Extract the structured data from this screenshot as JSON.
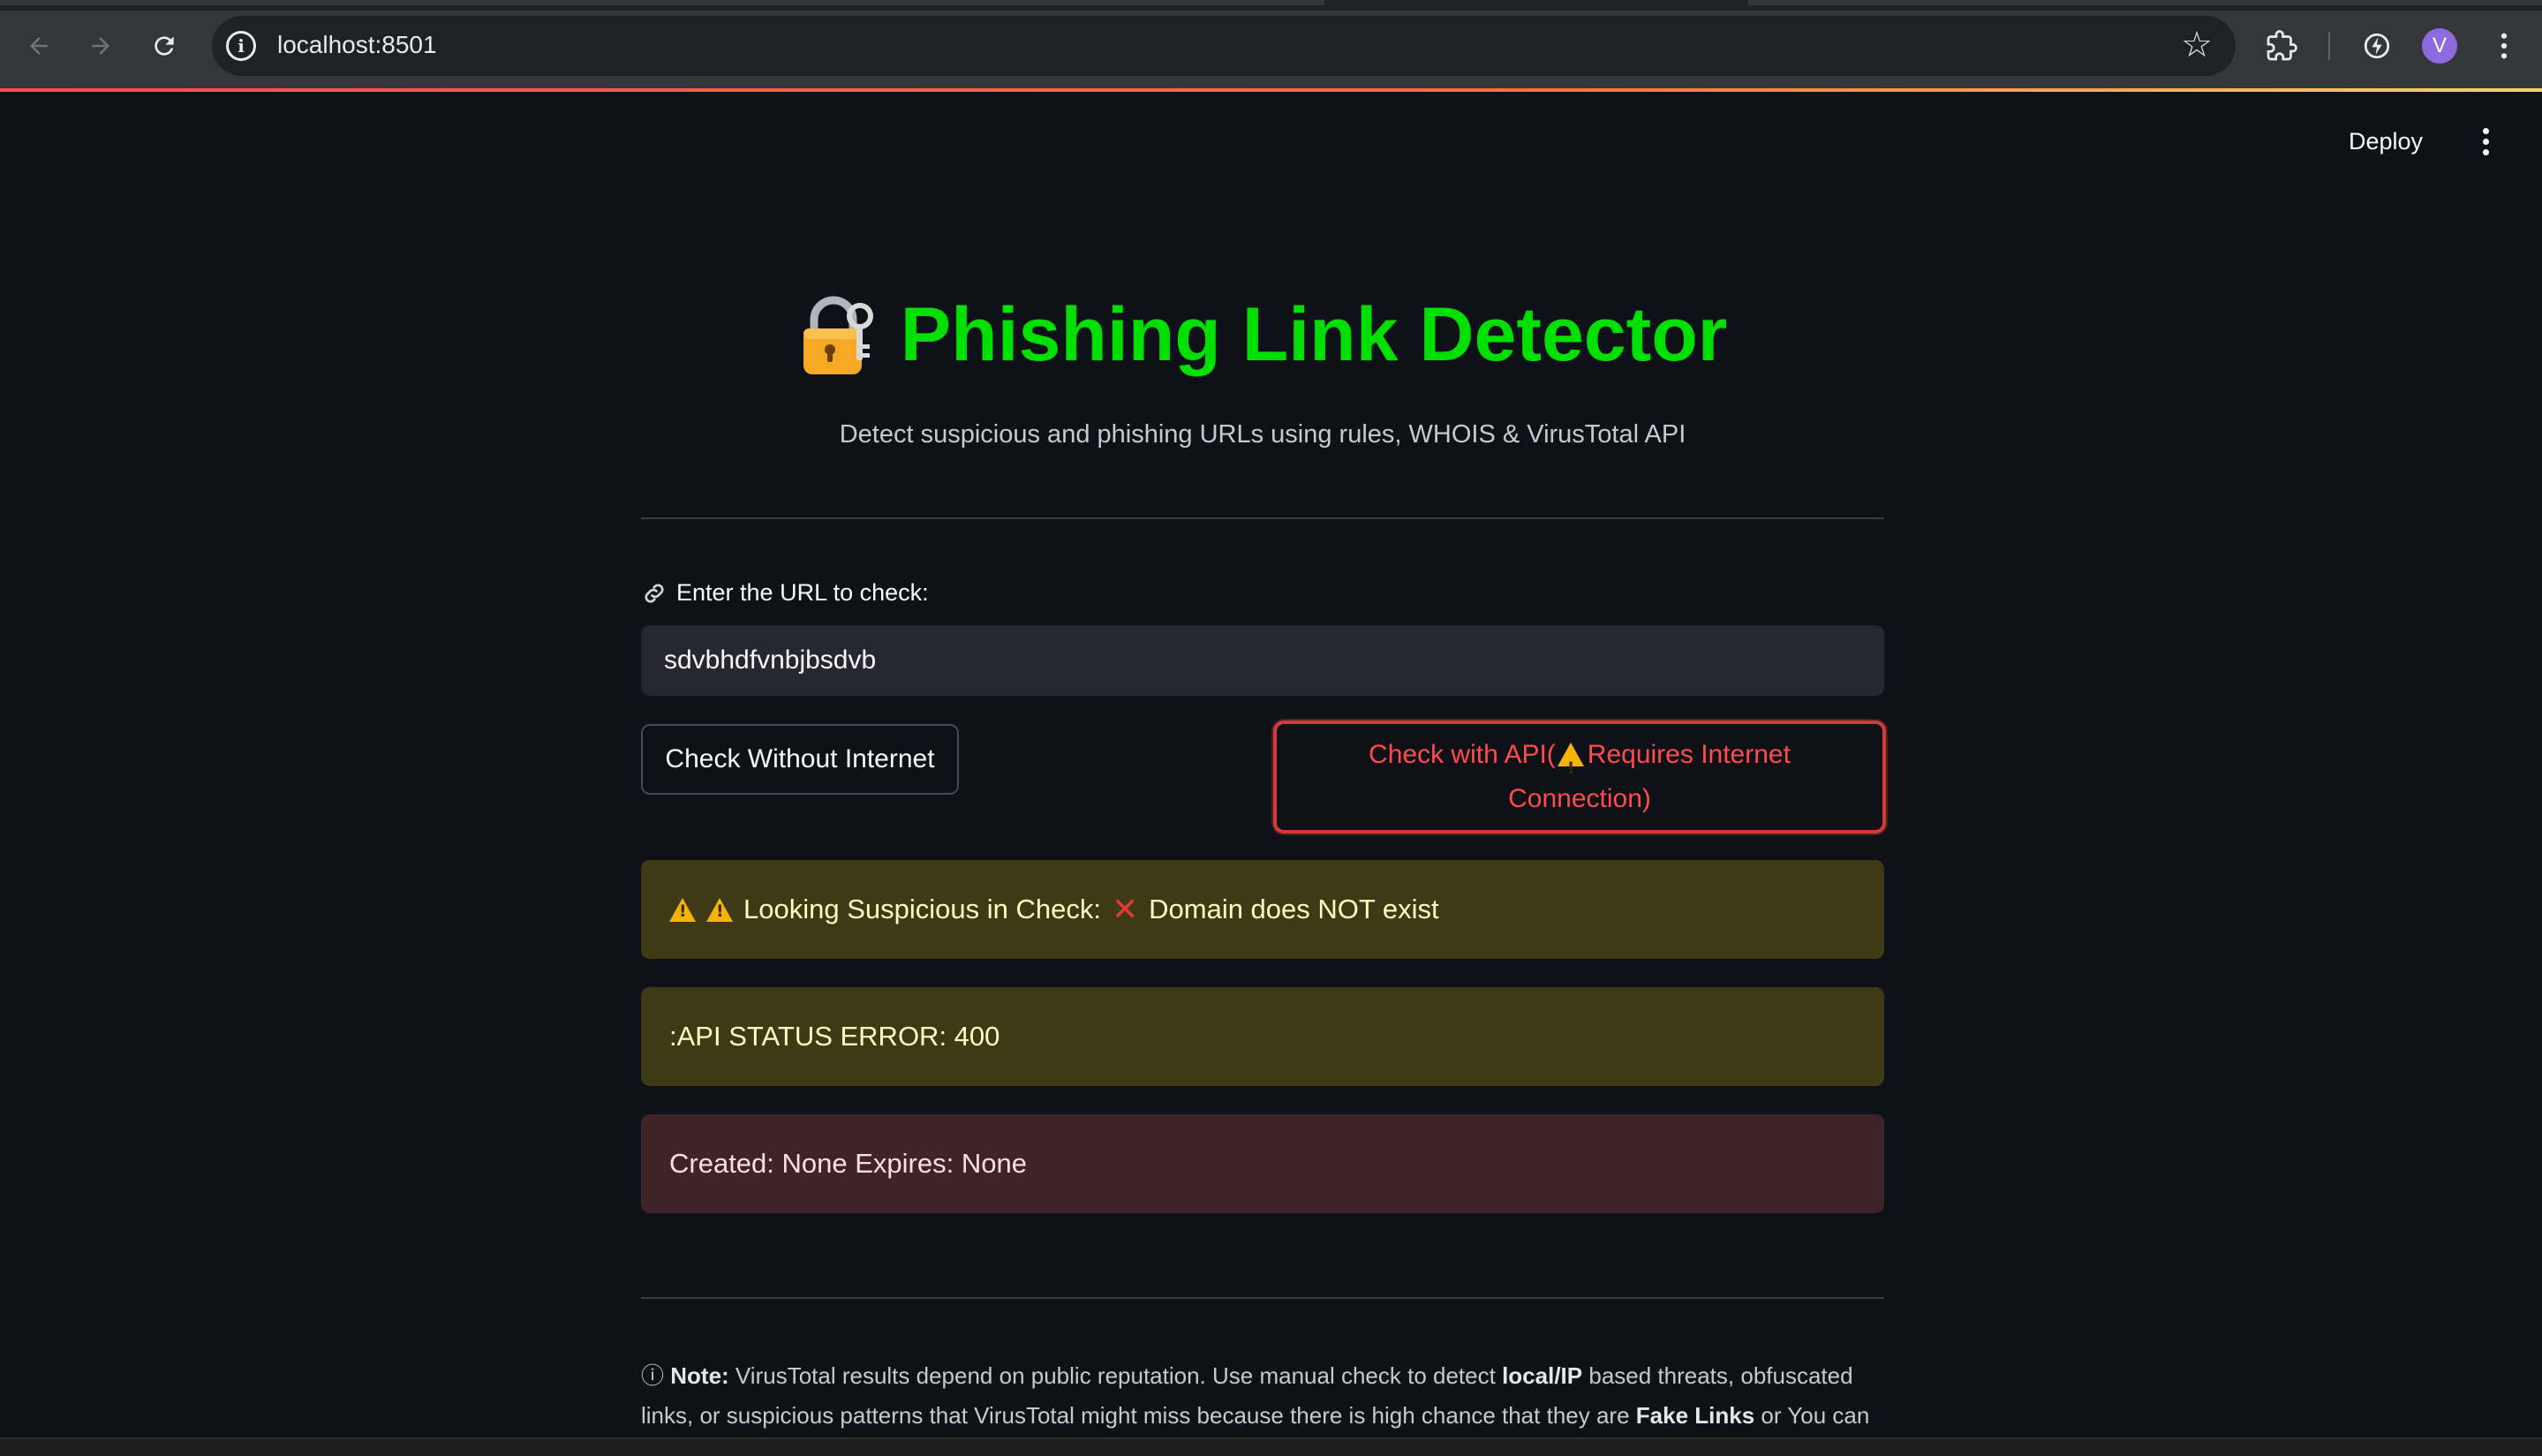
{
  "browser": {
    "url": "localhost:8501",
    "profile_initial": "V"
  },
  "header": {
    "deploy_label": "Deploy"
  },
  "app": {
    "title": "Phishing Link Detector",
    "subtitle": "Detect suspicious and phishing URLs using rules, WHOIS & VirusTotal API",
    "input_label": "Enter the URL to check:",
    "input_value": "sdvbhdfvnbjbsdvb",
    "btn_offline": "Check Without Internet",
    "btn_api_before": "Check with API(",
    "btn_api_after": "Requires Internet Connection)",
    "alert_suspicious": "Looking Suspicious in Check:",
    "alert_domain": "Domain does NOT exist",
    "alert_api": ":API STATUS ERROR: 400",
    "alert_whois": "Created: None Expires: None",
    "note_label": "Note:",
    "note_text_1": "VirusTotal results depend on public reputation. Use manual check to detect",
    "note_bold_1": "local/IP",
    "note_text_2": "based threats, obfuscated links, or suspicious patterns that VirusTotal might miss because there is high chance that they are",
    "note_bold_2": "Fake Links",
    "note_text_3": "or You can"
  },
  "colors": {
    "title": "#00e000",
    "api_button": "#ff4b4b",
    "warning_bg": "#3e3a16",
    "error_bg": "#3e2329",
    "page_bg": "#0e1117"
  }
}
